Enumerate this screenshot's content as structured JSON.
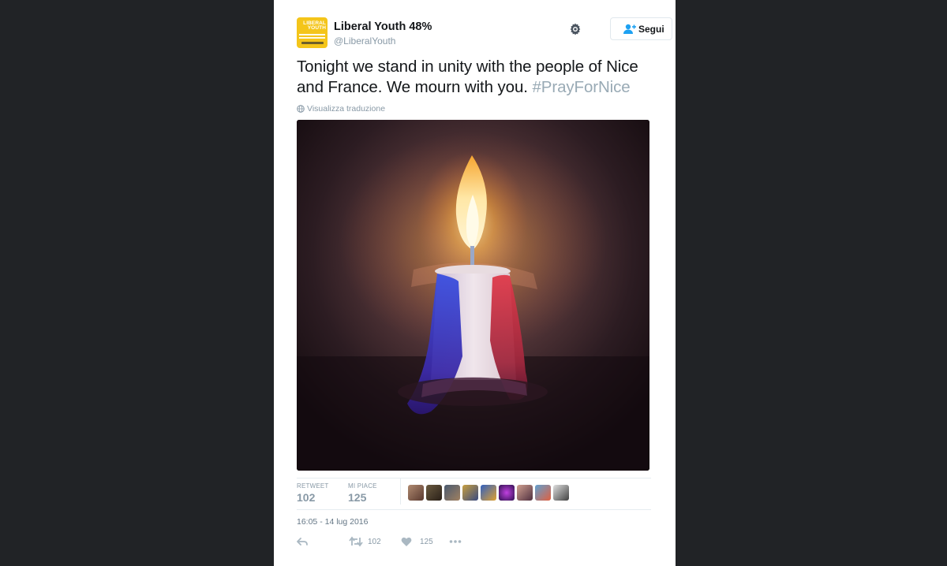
{
  "tweet": {
    "author_name": "Liberal Youth 48%",
    "handle": "@LiberalYouth",
    "follow_label": "Segui",
    "text": "Tonight we stand in unity with the people of Nice and France. We mourn with  you. ",
    "hashtag": "#PrayForNice",
    "translate_label": "Visualizza traduzione",
    "avatar": {
      "line1": "LIBERAL",
      "line2": "YOUTH"
    },
    "stats": {
      "retweets_label": "RETWEET",
      "retweets_value": "102",
      "likes_label": "MI PIACE",
      "likes_value": "125"
    },
    "timestamp": "16:05 - 14 lug 2016",
    "actions": {
      "reply_icon": "reply-icon",
      "retweet_count": "102",
      "like_count": "125",
      "more_icon": "more-icon"
    },
    "colors": {
      "accent": "#1da1f2",
      "hashtag": "#99aab5",
      "avatar_bg": "#f4c51a",
      "page_bg": "#212326"
    }
  }
}
